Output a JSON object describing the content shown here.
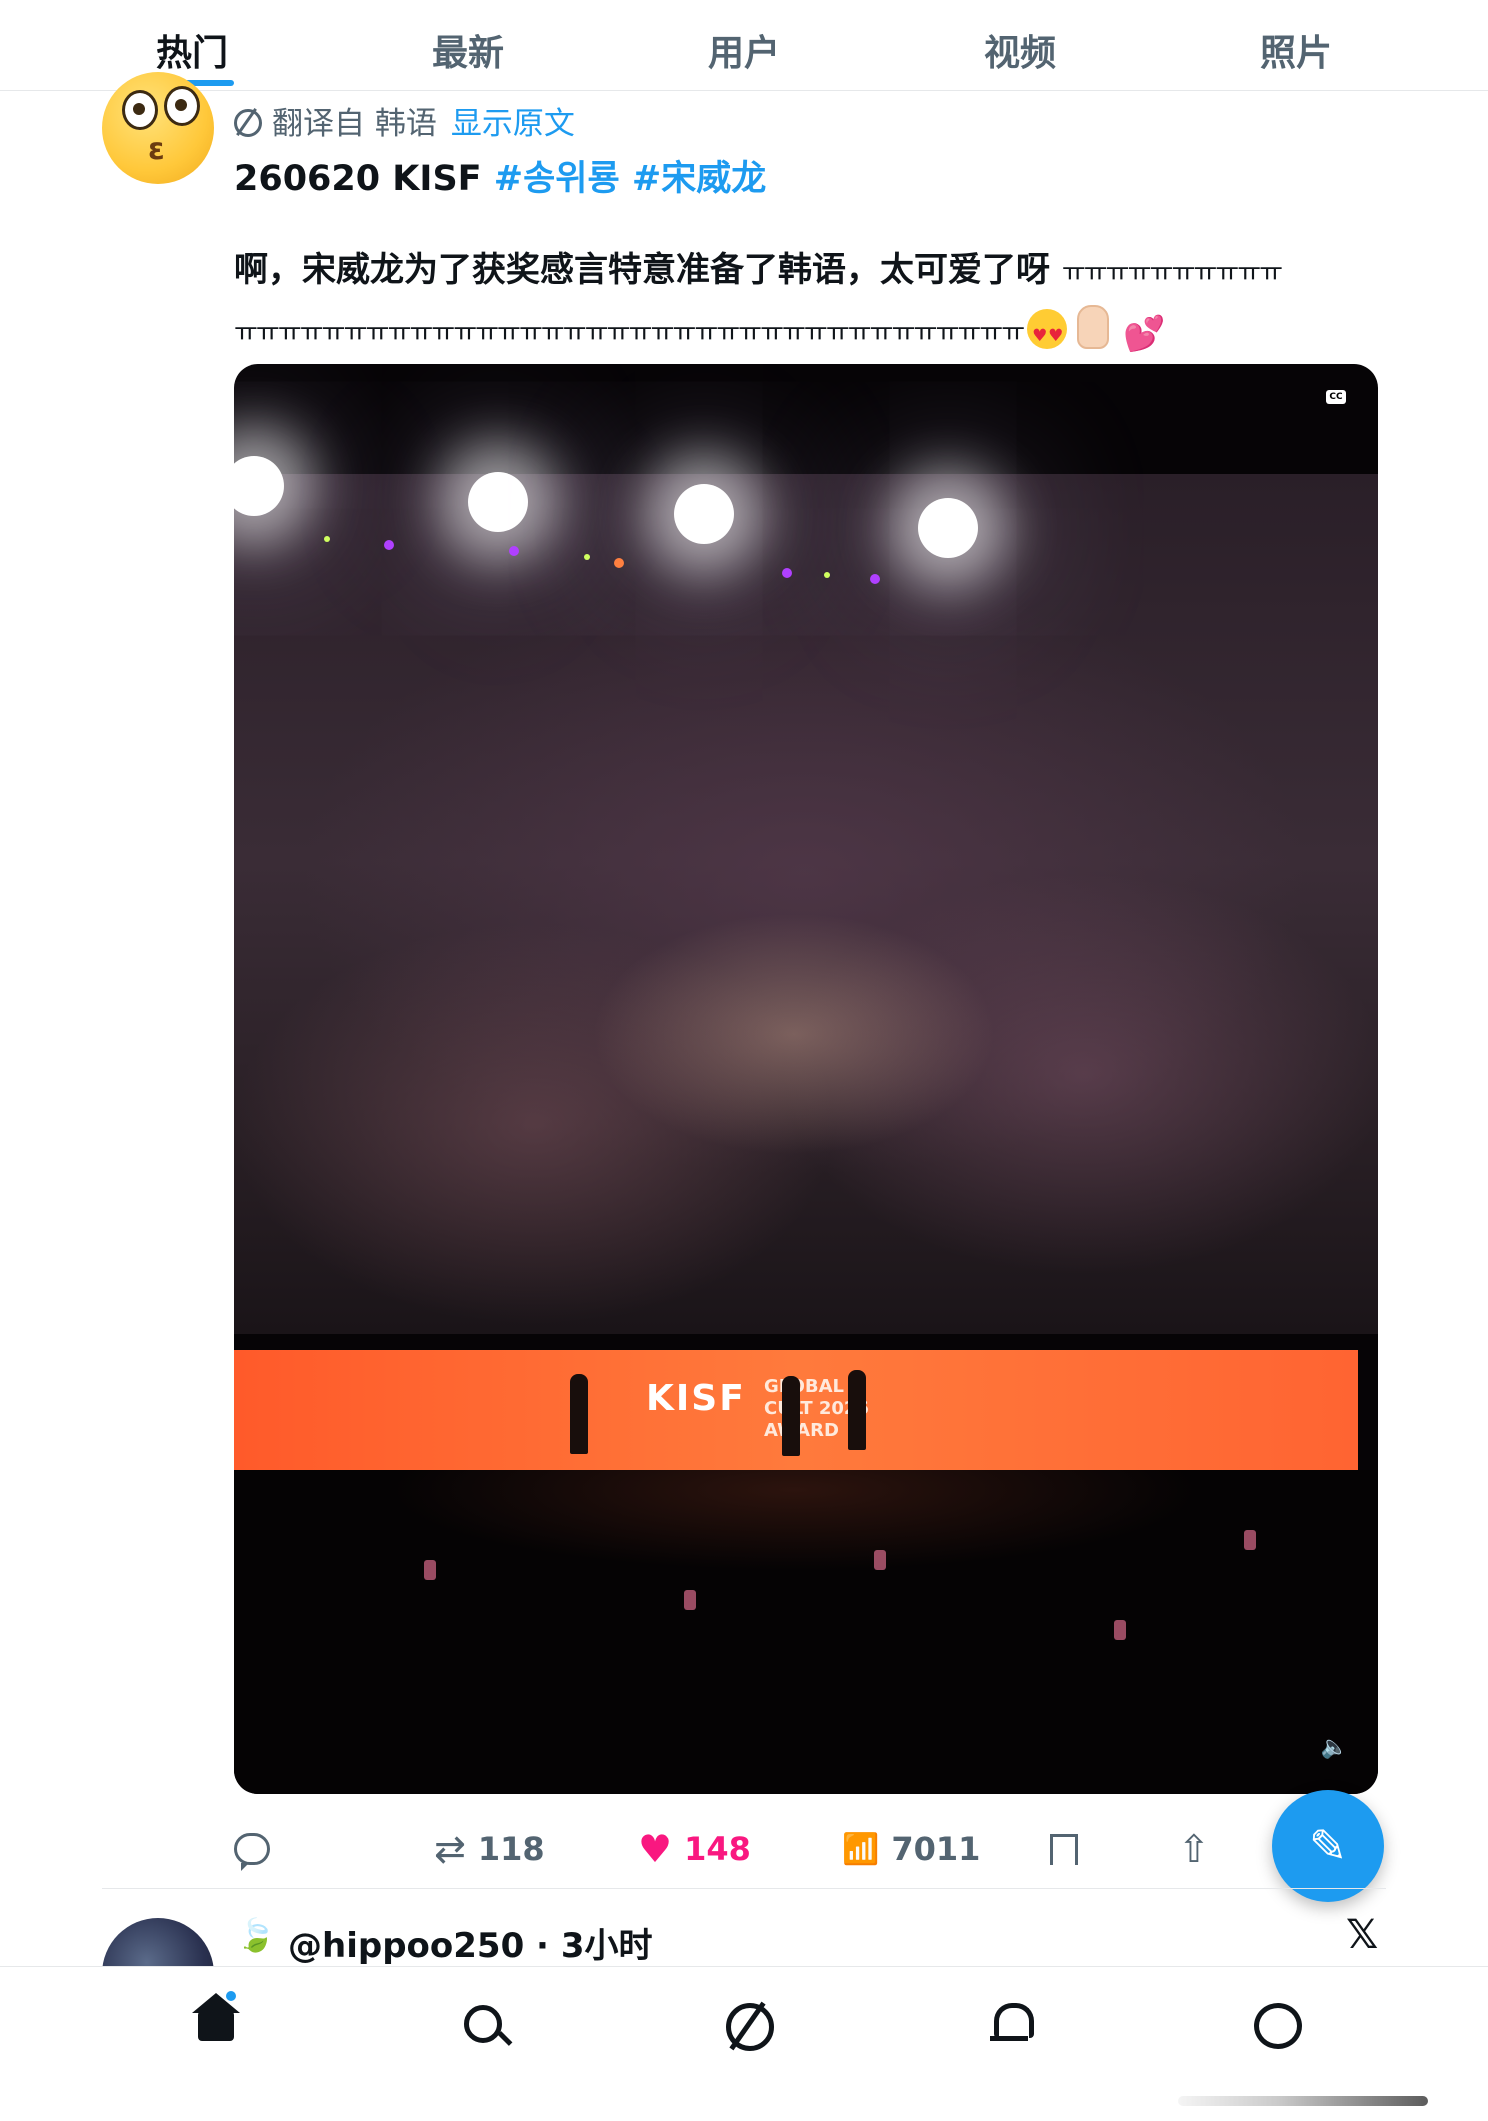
{
  "tabs": [
    {
      "label": "热门",
      "active": true
    },
    {
      "label": "最新",
      "active": false
    },
    {
      "label": "用户",
      "active": false
    },
    {
      "label": "视频",
      "active": false
    },
    {
      "label": "照片",
      "active": false
    }
  ],
  "post": {
    "translated_from": "翻译自 韩语",
    "show_original": "显示原文",
    "title_prefix": "260620 KISF",
    "hashtags": [
      "#송위룡",
      "#宋威龙"
    ],
    "body": "啊，宋威龙为了获奖感言特意准备了韩语，太可爱了呀",
    "body_trail": "ㅠㅠㅠㅠㅠㅠㅠㅠㅠㅠ",
    "body_trail2": "ㅠㅠㅠㅠㅠㅠㅠㅠㅠㅠㅠㅠㅠㅠㅠㅠㅠㅠㅠㅠㅠㅠㅠㅠㅠㅠㅠㅠㅠㅠㅠㅠㅠㅠㅠㅠ",
    "media": {
      "cc_label": "CC",
      "logo_text": "KISF",
      "logo_secondary": "GLOBAL\nCULT 2026\nAWARD"
    },
    "stats": {
      "retweets": "118",
      "likes": "148",
      "views": "7011"
    }
  },
  "next_post": {
    "handle": "@hippoo250 · 3小时"
  },
  "icons": {
    "compose": "compose-icon",
    "bottom_nav": [
      "home-icon",
      "search-icon",
      "grok-icon",
      "notifications-icon",
      "messages-icon"
    ]
  },
  "colors": {
    "accent": "#1d9bf0",
    "like": "#f91880",
    "text": "#0f1419",
    "muted": "#536471"
  }
}
